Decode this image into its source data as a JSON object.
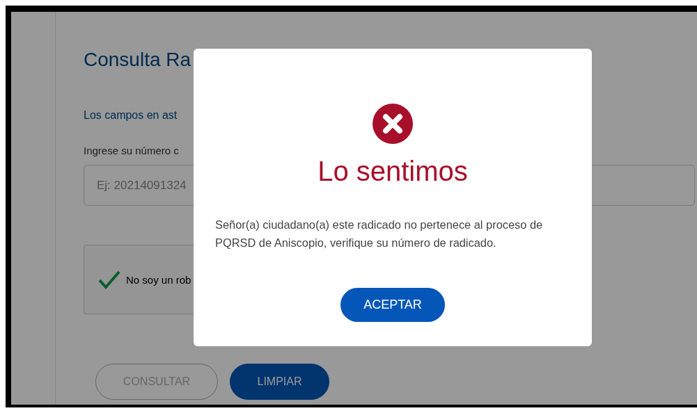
{
  "page": {
    "title": "Consulta Ra",
    "notice": "Los campos en ast",
    "field_label": "Ingrese su número c",
    "field": {
      "placeholder": "Ej: 20214091324"
    },
    "captcha": {
      "label": "No soy un rob",
      "checked": true
    },
    "buttons": [
      {
        "label": "CONSULTAR",
        "disabled": true
      },
      {
        "label": "LIMPIAR",
        "disabled": false
      }
    ]
  },
  "dialog": {
    "title": "Lo sentimos",
    "message": "Señor(a) ciudadano(a) este radicado no pertenece al proceso de PQRSD de Aniscopio, verifique su número de radicado.",
    "button": "ACEPTAR"
  }
}
